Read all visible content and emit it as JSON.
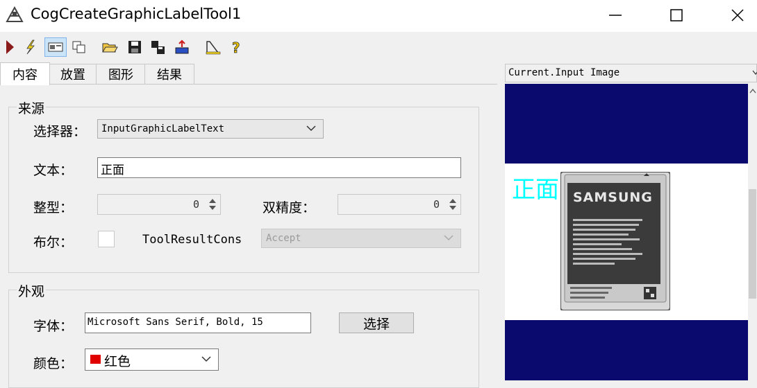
{
  "window": {
    "title": "CogCreateGraphicLabelTool1"
  },
  "toolbar": {
    "items": [
      "run-icon",
      "electric-run-icon",
      "show-ui-icon",
      "copy-window-icon",
      "open-icon",
      "save-icon",
      "save-copy-icon",
      "reset-icon",
      "image-tool-icon",
      "help-icon"
    ]
  },
  "tabs": [
    {
      "label": "内容",
      "active": true
    },
    {
      "label": "放置",
      "active": false
    },
    {
      "label": "图形",
      "active": false
    },
    {
      "label": "结果",
      "active": false
    }
  ],
  "source": {
    "title": "来源",
    "selector_label": "选择器：",
    "selector_value": "InputGraphicLabelText",
    "text_label": "文本：",
    "text_value": "正面",
    "int_label": "整型：",
    "int_value": "0",
    "double_label": "双精度：",
    "double_value": "0",
    "bool_label": "布尔：",
    "toolresult_label": "ToolResultCons",
    "toolresult_value": "Accept"
  },
  "appearance": {
    "title": "外观",
    "font_label": "字体：",
    "font_value": "Microsoft Sans Serif, Bold, 15",
    "select_button": "选择",
    "color_label": "颜色：",
    "color_value": "红色",
    "color_swatch": "#e00000"
  },
  "image_view": {
    "header": "Current.Input Image",
    "overlay_text": "正面",
    "overlay_color": "#00ffff",
    "background_color": "#0a0a6e",
    "battery_brand": "SAMSUNG"
  }
}
